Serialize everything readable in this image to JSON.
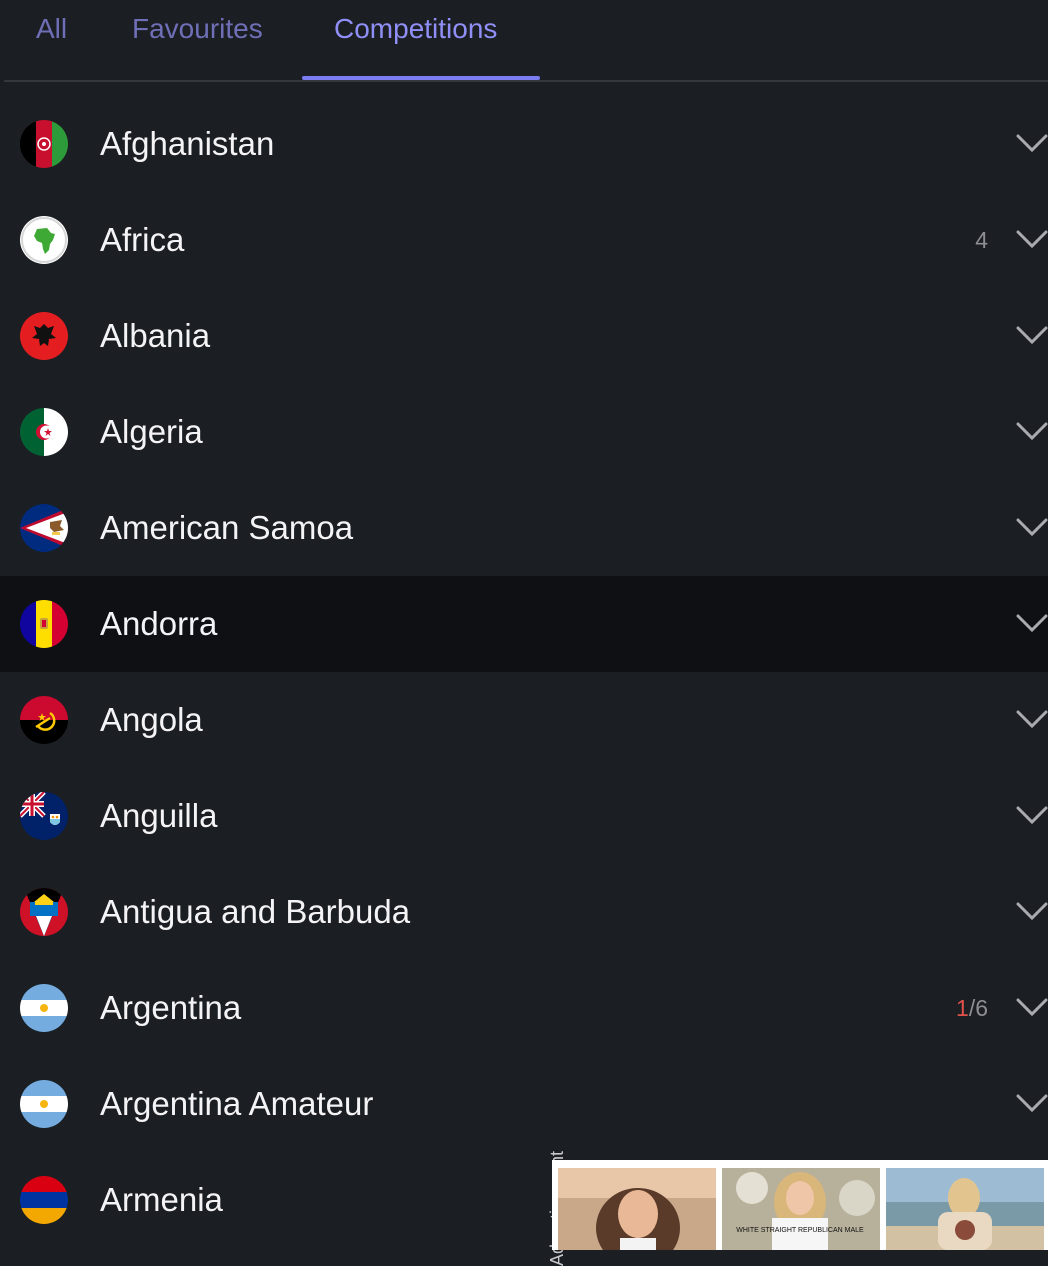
{
  "tabs": [
    {
      "label": "All"
    },
    {
      "label": "Favourites"
    },
    {
      "label": "Competitions"
    }
  ],
  "active_tab": "Competitions",
  "rows": [
    {
      "name": "Afghanistan",
      "count": null,
      "live": null,
      "flag": "afghanistan-flag-icon"
    },
    {
      "name": "Africa",
      "count": "4",
      "live": null,
      "flag": "africa-globe-icon"
    },
    {
      "name": "Albania",
      "count": null,
      "live": null,
      "flag": "albania-flag-icon"
    },
    {
      "name": "Algeria",
      "count": null,
      "live": null,
      "flag": "algeria-flag-icon"
    },
    {
      "name": "American Samoa",
      "count": null,
      "live": null,
      "flag": "american-samoa-flag-icon"
    },
    {
      "name": "Andorra",
      "count": null,
      "live": null,
      "flag": "andorra-flag-icon",
      "selected": true
    },
    {
      "name": "Angola",
      "count": null,
      "live": null,
      "flag": "angola-flag-icon"
    },
    {
      "name": "Anguilla",
      "count": null,
      "live": null,
      "flag": "anguilla-flag-icon"
    },
    {
      "name": "Antigua and Barbuda",
      "count": null,
      "live": null,
      "flag": "antigua-and-barbuda-flag-icon"
    },
    {
      "name": "Argentina",
      "count": "/6",
      "live": "1",
      "flag": "argentina-flag-icon"
    },
    {
      "name": "Argentina Amateur",
      "count": null,
      "live": null,
      "flag": "argentina-flag-icon"
    },
    {
      "name": "Armenia",
      "count": null,
      "live": null,
      "flag": "armenia-flag-icon"
    }
  ],
  "ad": {
    "label": "Advertisement",
    "shirt_text": "WHITE STRAIGHT REPUBLICAN MALE"
  },
  "colors": {
    "background": "#1b1e22",
    "selected_row": "#0f1013",
    "accent": "#7b7bf2",
    "live_count": "#e0514a"
  }
}
